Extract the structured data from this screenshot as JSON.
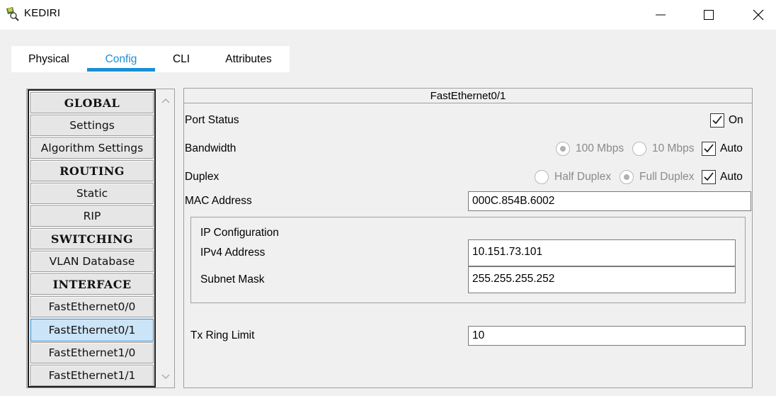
{
  "window": {
    "title": "KEDIRI",
    "minimize_icon": "minimize-icon",
    "maximize_icon": "maximize-icon",
    "close_icon": "close-icon"
  },
  "tabs": [
    {
      "label": "Physical",
      "active": false
    },
    {
      "label": "Config",
      "active": true
    },
    {
      "label": "CLI",
      "active": false
    },
    {
      "label": "Attributes",
      "active": false
    }
  ],
  "sidebar": {
    "items": [
      {
        "label": "GLOBAL",
        "type": "header"
      },
      {
        "label": "Settings",
        "type": "item"
      },
      {
        "label": "Algorithm Settings",
        "type": "item"
      },
      {
        "label": "ROUTING",
        "type": "header"
      },
      {
        "label": "Static",
        "type": "item"
      },
      {
        "label": "RIP",
        "type": "item"
      },
      {
        "label": "SWITCHING",
        "type": "header"
      },
      {
        "label": "VLAN Database",
        "type": "item"
      },
      {
        "label": "INTERFACE",
        "type": "header"
      },
      {
        "label": "FastEthernet0/0",
        "type": "item"
      },
      {
        "label": "FastEthernet0/1",
        "type": "item",
        "selected": true
      },
      {
        "label": "FastEthernet1/0",
        "type": "item"
      },
      {
        "label": "FastEthernet1/1",
        "type": "item"
      }
    ]
  },
  "interface": {
    "title": "FastEthernet0/1",
    "port_status": {
      "label": "Port Status",
      "on_label": "On",
      "on": true
    },
    "bandwidth": {
      "label": "Bandwidth",
      "option_100": "100 Mbps",
      "option_10": "10 Mbps",
      "selected": "100 Mbps",
      "auto_label": "Auto",
      "auto": true
    },
    "duplex": {
      "label": "Duplex",
      "option_half": "Half Duplex",
      "option_full": "Full Duplex",
      "selected": "Full Duplex",
      "auto_label": "Auto",
      "auto": true
    },
    "mac": {
      "label": "MAC Address",
      "value": "000C.854B.6002"
    },
    "ip_config": {
      "title": "IP Configuration",
      "ipv4_label": "IPv4 Address",
      "ipv4_value": "10.151.73.101",
      "mask_label": "Subnet Mask",
      "mask_value": "255.255.255.252"
    },
    "tx_ring": {
      "label": "Tx Ring Limit",
      "value": "10"
    }
  },
  "colors": {
    "accent": "#1a8fd6",
    "selected_item_bg": "#cce4f7"
  }
}
